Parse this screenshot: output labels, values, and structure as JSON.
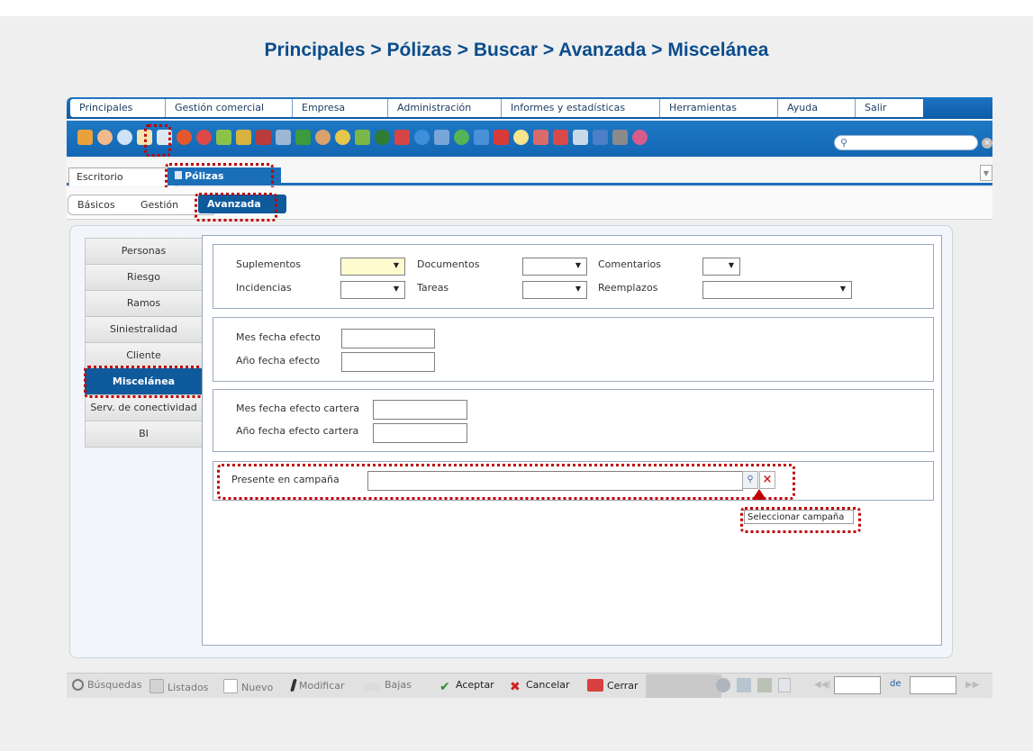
{
  "page_title": "Principales > Pólizas > Buscar > Avanzada > Miscelánea",
  "menu": [
    "Principales",
    "Gestión comercial",
    "Empresa",
    "Administración",
    "Informes y estadísticas",
    "Herramientas",
    "Ayuda",
    "Salir"
  ],
  "search": {
    "placeholder": ""
  },
  "tabs": {
    "escritorio": "Escritorio",
    "polizas": "Pólizas"
  },
  "subtabs": {
    "basicos": "Básicos",
    "gestion": "Gestión",
    "avanzada": "Avanzada"
  },
  "leftnav": [
    "Personas",
    "Riesgo",
    "Ramos",
    "Siniestralidad",
    "Cliente",
    "Miscelánea",
    "Serv. de conectividad",
    "BI"
  ],
  "group1": {
    "suplementos": "Suplementos",
    "documentos": "Documentos",
    "comentarios": "Comentarios",
    "incidencias": "Incidencias",
    "tareas": "Tareas",
    "reemplazos": "Reemplazos"
  },
  "group2": {
    "mes": "Mes fecha efecto",
    "anio": "Año fecha efecto"
  },
  "group3": {
    "mes": "Mes fecha efecto cartera",
    "anio": "Año fecha efecto cartera"
  },
  "group4": {
    "campana": "Presente en campaña"
  },
  "tooltip": "Seleccionar campaña",
  "toolbar": {
    "busquedas": "Búsquedas",
    "listados": "Listados",
    "nuevo": "Nuevo",
    "modificar": "Modificar",
    "bajas": "Bajas",
    "aceptar": "Aceptar",
    "cancelar": "Cancelar",
    "cerrar": "Cerrar",
    "de": "de"
  },
  "colors": {
    "highlight": "#c00000",
    "active_tab": "#1b6eb8",
    "title": "#0b4c8c"
  }
}
